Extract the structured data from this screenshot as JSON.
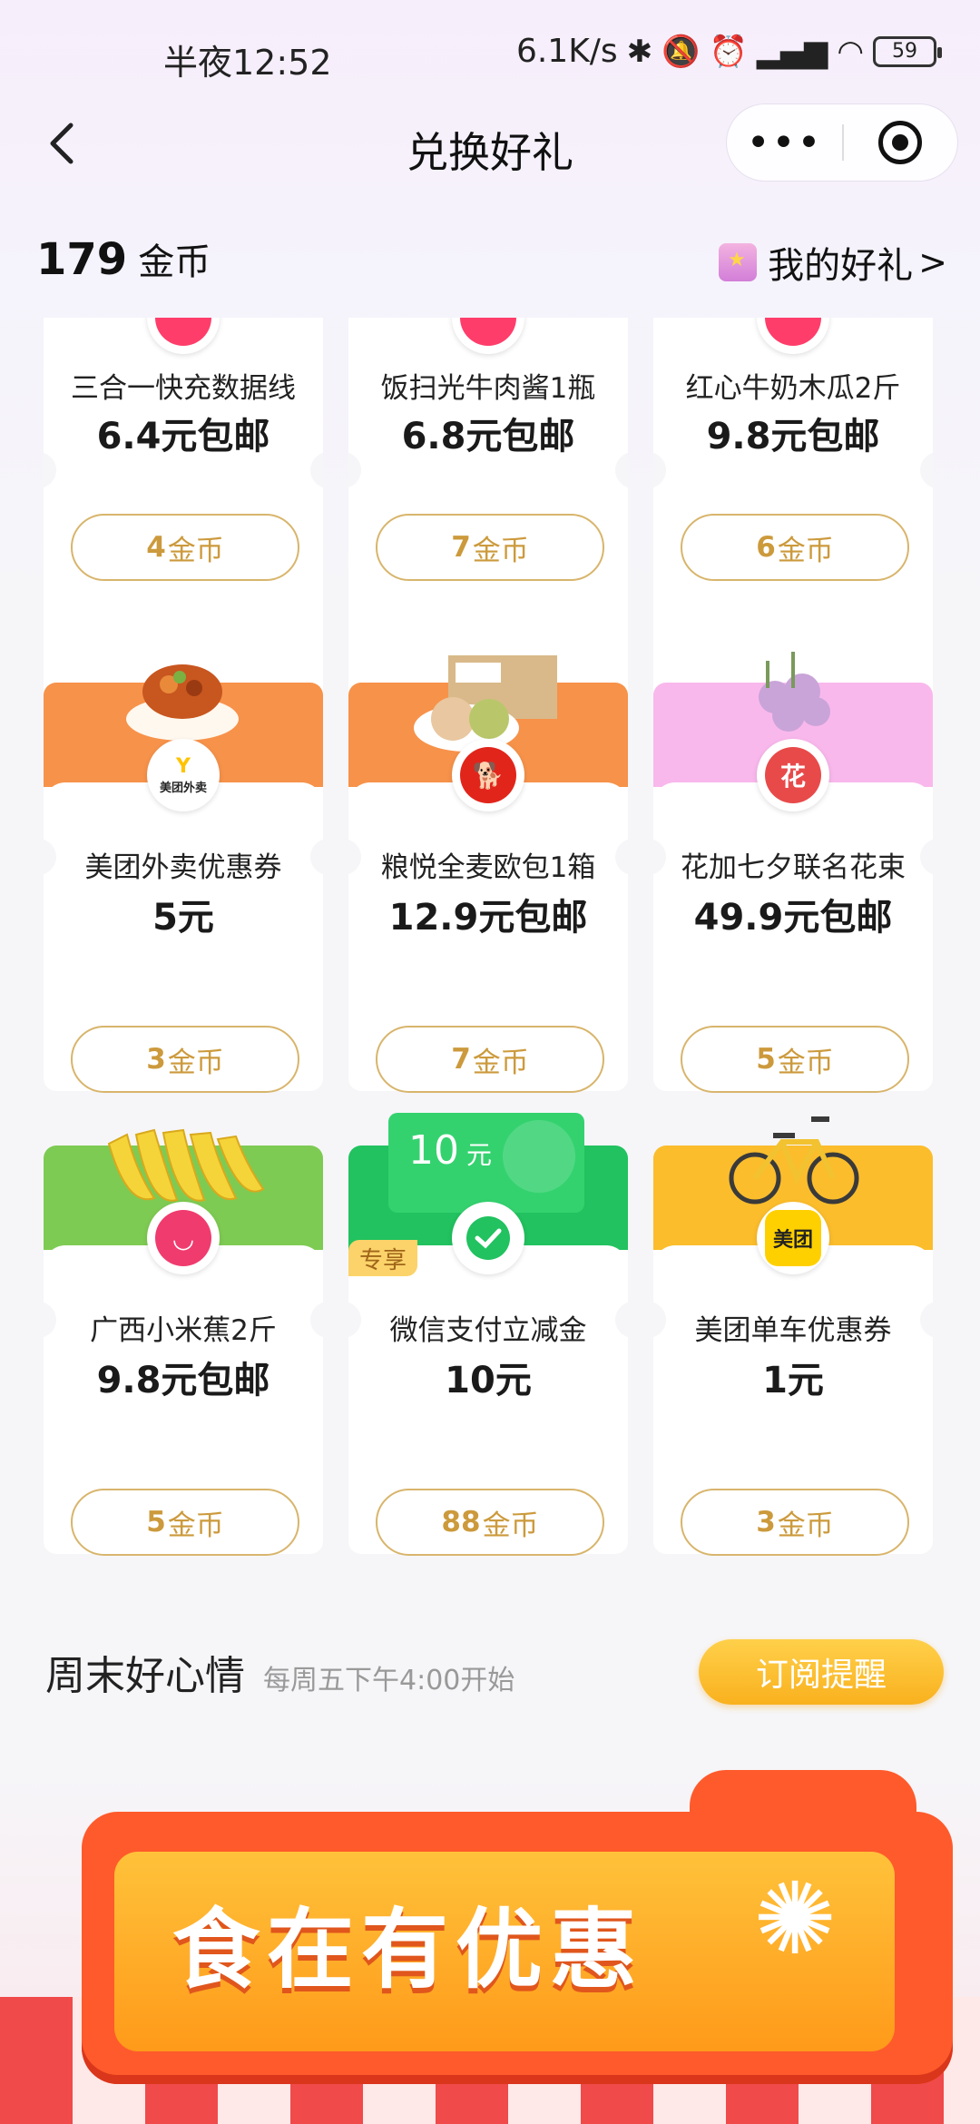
{
  "status_bar": {
    "time": "半夜12:52",
    "speed": "6.1K/s",
    "battery": "59"
  },
  "header": {
    "title": "兑换好礼",
    "more_label": "•••"
  },
  "coins": {
    "amount": "179",
    "unit": "金币"
  },
  "my_gifts": {
    "label": "我的好礼",
    "chevron": ">"
  },
  "items": [
    {
      "name": "三合一快充数据线",
      "price": "6.4元包邮",
      "cost": "4",
      "cost_unit": "金币"
    },
    {
      "name": "饭扫光牛肉酱1瓶",
      "price": "6.8元包邮",
      "cost": "7",
      "cost_unit": "金币"
    },
    {
      "name": "红心牛奶木瓜2斤",
      "price": "9.8元包邮",
      "cost": "6",
      "cost_unit": "金币"
    },
    {
      "name": "美团外卖优惠券",
      "price": "5元",
      "cost": "3",
      "cost_unit": "金币",
      "logo_text": "美团外卖"
    },
    {
      "name": "粮悦全麦欧包1箱",
      "price": "12.9元包邮",
      "cost": "7",
      "cost_unit": "金币"
    },
    {
      "name": "花加七夕联名花束",
      "price": "49.9元包邮",
      "cost": "5",
      "cost_unit": "金币",
      "logo_text": "花"
    },
    {
      "name": "广西小米蕉2斤",
      "price": "9.8元包邮",
      "cost": "5",
      "cost_unit": "金币"
    },
    {
      "name": "微信支付立减金",
      "price": "10元",
      "cost": "88",
      "cost_unit": "金币",
      "badge": "专享",
      "ticket_amount": "10",
      "ticket_unit": "元"
    },
    {
      "name": "美团单车优惠券",
      "price": "1元",
      "cost": "3",
      "cost_unit": "金币",
      "logo_text": "美团"
    }
  ],
  "section": {
    "title": "周末好心情",
    "subtitle": "每周五下午4:00开始",
    "subscribe_label": "订阅提醒"
  },
  "promo": {
    "text": "食在有优惠"
  },
  "colors": {
    "gold_text": "#cc9a3c",
    "gold_border": "#d8b56c",
    "orange_banner": "#f7924a",
    "pink_banner": "#f9b8ec",
    "green_banner": "#7ecb53",
    "wechat_green": "#21c25f",
    "yellow_banner": "#fbbd2c"
  }
}
